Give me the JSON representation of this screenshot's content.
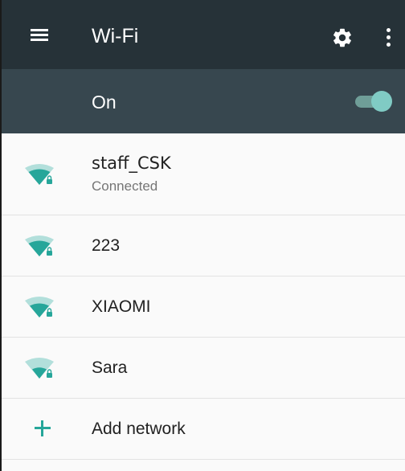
{
  "toolbar": {
    "title": "Wi-Fi",
    "menu_icon": "menu-icon",
    "settings_icon": "gear-icon",
    "more_icon": "more-vert-icon"
  },
  "master_switch": {
    "label": "On",
    "state": "on"
  },
  "networks": [
    {
      "ssid": "staff_CSK",
      "status": "Connected",
      "icon": "wifi-lock-icon"
    },
    {
      "ssid": "223",
      "icon": "wifi-lock-icon"
    },
    {
      "ssid": "XIAOMI",
      "icon": "wifi-lock-icon"
    },
    {
      "ssid": "Sara",
      "icon": "wifi-lock-icon"
    }
  ],
  "add_network": {
    "label": "Add network",
    "icon": "plus-icon"
  },
  "colors": {
    "toolbar": "#263238",
    "switch_bar": "#37474f",
    "accent": "#26a69a",
    "toggle_thumb": "#80cbc4"
  }
}
